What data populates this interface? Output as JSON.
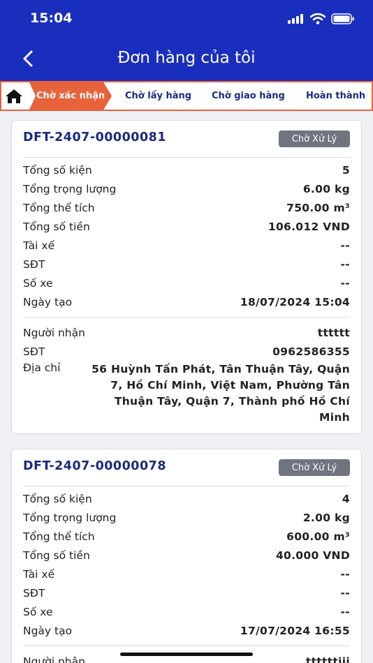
{
  "status_bar": {
    "time": "15:04"
  },
  "header": {
    "title": "Đơn hàng của tôi",
    "back_icon": "chevron-left-icon"
  },
  "tabs": {
    "home_icon": "home-icon",
    "active": "Chờ xác nhận",
    "items": [
      "Chờ lấy hàng",
      "Chờ giao hàng",
      "Hoàn thành"
    ],
    "accent": "#e8623a"
  },
  "labels": {
    "packages": "Tổng số kiện",
    "weight": "Tổng trọng lượng",
    "volume": "Tổng thể tích",
    "amount": "Tổng số tiền",
    "driver": "Tài xế",
    "phone": "SĐT",
    "plate": "Số xe",
    "created": "Ngày tạo",
    "receiver": "Người nhận",
    "receiver_phone": "SĐT",
    "address": "Địa chỉ"
  },
  "orders": [
    {
      "id": "DFT-2407-00000081",
      "status": "Chờ Xử Lý",
      "packages": "5",
      "weight": "6.00 kg",
      "volume": "750.00 m³",
      "amount": "106.012 VND",
      "driver": "--",
      "phone": "--",
      "plate": "--",
      "created": "18/07/2024 15:04",
      "receiver": "tttttt",
      "receiver_phone": "0962586355",
      "address": "56 Huỳnh Tấn Phát, Tân Thuận Tây, Quận 7, Hồ Chí Minh, Việt Nam, Phường Tân Thuận Tây, Quận 7, Thành phố Hồ Chí Minh"
    },
    {
      "id": "DFT-2407-00000078",
      "status": "Chờ Xử Lý",
      "packages": "4",
      "weight": "2.00 kg",
      "volume": "600.00 m³",
      "amount": "40.000 VND",
      "driver": "--",
      "phone": "--",
      "plate": "--",
      "created": "17/07/2024 16:55",
      "receiver": "ttttttiii"
    }
  ],
  "colors": {
    "header": "#1a2ebd",
    "order_id": "#1a2a7d",
    "badge": "#6e7480"
  }
}
